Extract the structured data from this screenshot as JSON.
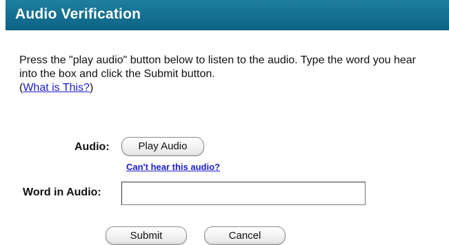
{
  "header": {
    "title": "Audio Verification"
  },
  "instructions": {
    "text": "Press the \"play audio\" button below to listen to the audio. Type the word you hear into the box and click the Submit button.",
    "help_open": "(",
    "help_link": "What is This?",
    "help_close": ")"
  },
  "audio": {
    "label": "Audio:",
    "play_button": "Play Audio",
    "cant_hear_link": "Can't hear this audio?"
  },
  "word": {
    "label": "Word in Audio:",
    "value": "",
    "placeholder": ""
  },
  "actions": {
    "submit": "Submit",
    "cancel": "Cancel"
  }
}
